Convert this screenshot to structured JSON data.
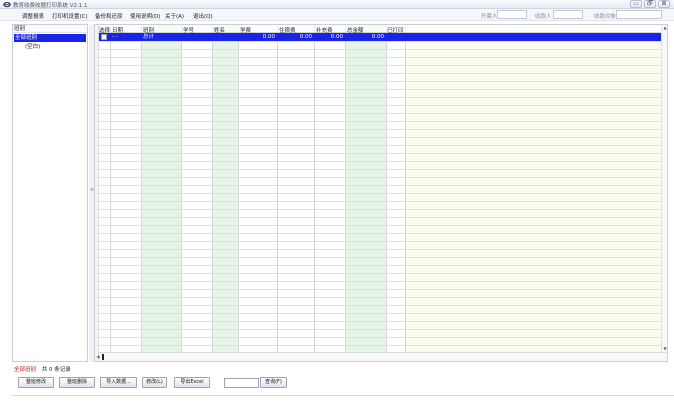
{
  "window": {
    "title": "教育收费收据打印系统 V2.1.1",
    "icon": "app-eye-icon",
    "buttons": {
      "minimize": "▭",
      "maximize": "🗗",
      "close": "⊠"
    }
  },
  "menu": {
    "items": [
      "调整报表",
      "打印机设置(C)",
      "备份和还原",
      "使用说明(D)",
      "关于(A)",
      "退出(Q)"
    ],
    "filters": [
      {
        "label": "开票人",
        "value": ""
      },
      {
        "label": "收款人",
        "value": ""
      },
      {
        "label": "收款对象",
        "value": ""
      }
    ]
  },
  "left_panel": {
    "header": "班别",
    "selected_item": "全部班别",
    "child_item": "(空白)"
  },
  "grid": {
    "columns": [
      "选择",
      "日期",
      "班别",
      "学号",
      "姓名",
      "学费",
      "住宿费",
      "补充费",
      "总金额",
      "已打印"
    ],
    "selected_row": {
      "checked": false,
      "date": "- -",
      "class": "总计",
      "tuition": "0.00",
      "accommodation": "0.00",
      "supplement": "0.00",
      "total": "0.00"
    }
  },
  "status_bar": {
    "current": "全部班别",
    "count_text": "共 0 条记录"
  },
  "buttons": [
    "整班修改",
    "整班删除",
    "导入数据...",
    "修改(L)",
    "导出Excel",
    "查询(F)"
  ],
  "query_value": "",
  "colors": {
    "selection": "#1a23e8",
    "green_column": "#e6f5e7",
    "status_red": "#c01818"
  }
}
